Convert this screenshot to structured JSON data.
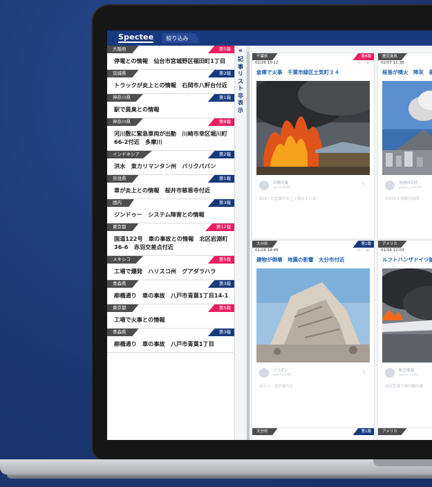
{
  "app": {
    "logo": "Spectee",
    "filter_tab": "絞り込み",
    "collapse_arrow": "«",
    "collapse_label": "記事リスト非表示"
  },
  "colors": {
    "brand_navy": "#17397e",
    "report_pink": "#e91e63",
    "background": "#1d3a78"
  },
  "list": [
    {
      "region": "大阪府",
      "report": "第5報",
      "tone": "pink",
      "title": "停電との情報　仙台市宮城野区福田町1丁目"
    },
    {
      "region": "茨城県",
      "report": "第2報",
      "tone": "blue",
      "title": "トラックが炎上との情報　石岡市八軒台付近"
    },
    {
      "region": "神奈川県",
      "report": "第1報",
      "tone": "blue",
      "title": "駅で異臭との情報"
    },
    {
      "region": "神奈川県",
      "report": "第8報",
      "tone": "pink",
      "title": "河川敷に緊急車両が出動　川崎市幸区堀川町66-2付近　多摩川"
    },
    {
      "region": "インドネシア",
      "report": "第2報",
      "tone": "blue",
      "title": "洪水　東カリマンタン州　バリクパパン"
    },
    {
      "region": "奈良県",
      "report": "第1報",
      "tone": "blue",
      "title": "車が炎上との情報　桜井市慈恩寺付近"
    },
    {
      "region": "国内",
      "report": "第3報",
      "tone": "blue",
      "title": "ジンドゥー　システム障害との情報"
    },
    {
      "region": "東京都",
      "report": "第12報",
      "tone": "pink",
      "title": "国道122号　車の事故との情報　北区岩淵町36-6　赤羽交差点付近"
    },
    {
      "region": "メキシコ",
      "report": "第5報",
      "tone": "pink",
      "title": "工場で爆発　ハリスコ州　グアダラハラ"
    },
    {
      "region": "青森県",
      "report": "第3報",
      "tone": "blue",
      "title": "柳橋通り　車の事故　八戸市青葉1丁目14-1"
    },
    {
      "region": "東京都",
      "report": "第5報",
      "tone": "pink",
      "title": "工場で火事との情報"
    },
    {
      "region": "青森県",
      "report": "第3報",
      "tone": "blue",
      "title": "柳橋通り　車の事故　八戸市青葉1丁目"
    }
  ],
  "cards": [
    {
      "region": "千葉県",
      "report": "第8報",
      "tone": "pink",
      "time": "02/26 15:12",
      "title": "倉庫で火事　千葉市緑区土気町３４",
      "icons": "✎ ★",
      "image": "fire-warehouse",
      "user": "白鷺同業",
      "handle": "@user4580",
      "text": "新はくの倉庫がすごく燃えている！"
    },
    {
      "region": "鹿児島県",
      "report": "",
      "tone": "pink",
      "time": "02/07 11:38",
      "title": "桜島が噴火　降灰　垂",
      "icons": "",
      "image": "volcano",
      "user": "地理研究所",
      "handle": "@geo_report01",
      "text": "今回の大規模日向西"
    },
    {
      "region": "大分県",
      "report": "第1報",
      "tone": "blue",
      "time": "01/28 14:49",
      "title": "建物が倒壊　地震の影響　大分市付近",
      "icons": "✎ ★",
      "image": "collapsed-building",
      "user": "デコポン",
      "handle": "@onliaas08",
      "text": "あらら、道が崩れた"
    },
    {
      "region": "アメリカ",
      "report": "",
      "tone": "blue",
      "time": "01/08 12:03",
      "title": "ルフトハンザドイツ航",
      "icons": "",
      "image": "plane-fire",
      "user": "航空情報",
      "handle": "@avia_news",
      "text": "成田空港で飛行機の事"
    },
    {
      "region": "大分県",
      "report": "第1報",
      "tone": "blue",
      "time": "",
      "title": "",
      "icons": "",
      "image": "none",
      "user": "",
      "handle": "",
      "text": ""
    },
    {
      "region": "アメリカ",
      "report": "",
      "tone": "blue",
      "time": "",
      "title": "",
      "icons": "",
      "image": "none",
      "user": "",
      "handle": "",
      "text": ""
    }
  ]
}
